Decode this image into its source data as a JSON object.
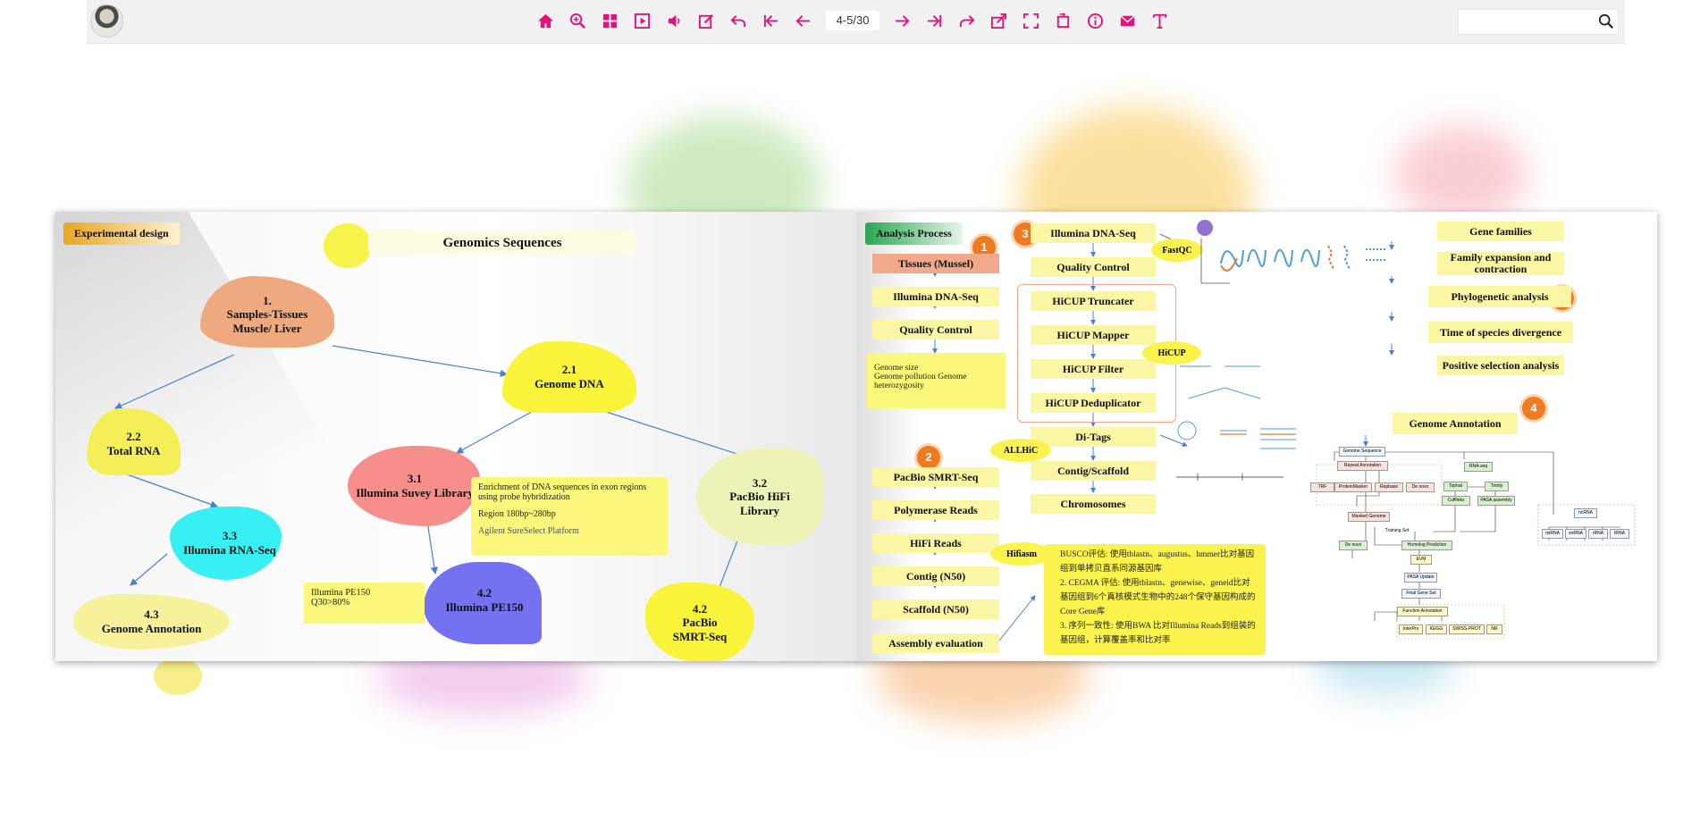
{
  "toolbar": {
    "page_indicator": "4-5/30",
    "search_placeholder": "",
    "icons": [
      "home-icon",
      "zoom-in-icon",
      "thumbnails-icon",
      "autoplay-icon",
      "sound-icon",
      "annotate-icon",
      "back-icon",
      "first-page-icon",
      "prev-page-icon",
      "next-page-icon",
      "last-page-icon",
      "forward-icon",
      "share-icon",
      "fullscreen-icon",
      "rotate-icon",
      "info-icon",
      "email-icon",
      "text-icon"
    ],
    "accent_color": "#e2137a"
  },
  "left_page": {
    "tag": "Experimental design",
    "title": "Genomics Sequences",
    "nodes": {
      "n1": "1.\nSamples-Tissues\nMuscle/ Liver",
      "n21": "2.1\nGenome DNA",
      "n22": "2.2\nTotal RNA",
      "n31": "3.1\nIllumina Suvey Library",
      "n32": "3.2\nPacBio HiFi\nLibrary",
      "n33": "3.3\nIllumina RNA-Seq",
      "n42a": "4.2\nIllumina PE150",
      "n42b": "4.2\nPacBio\nSMRT-Seq",
      "n43": "4.3\nGenome Annotation"
    },
    "note_enrich": "Enrichment of DNA sequences in exon regions using probe hybridization",
    "note_region": "Region 180bp~280bp",
    "note_platform": "Agilent SureSelect Platform",
    "note_pe150_1": "Illumina PE150",
    "note_pe150_2": "Q30>80%"
  },
  "right_page": {
    "tag": "Analysis Process",
    "col1": [
      "Tissues (Mussel)",
      "Illumina DNA-Seq",
      "Quality Control"
    ],
    "col1_note": [
      "Genome size",
      "Genome pollution Genome",
      "heterozygosity"
    ],
    "col1b": [
      "PacBio SMRT-Seq",
      "Polymerase Reads",
      "HiFi Reads",
      "Contig (N50)",
      "Scaffold (N50)",
      "Assembly evaluation"
    ],
    "col2": [
      "Illumina DNA-Seq",
      "Quality Control",
      "HiCUP Truncater",
      "HiCUP Mapper",
      "HiCUP Filter",
      "HiCUP Deduplicator",
      "Di-Tags",
      "Contig/Scaffold",
      "Chromosomes"
    ],
    "ovals": {
      "fastqc": "FastQC",
      "hicup": "HiCUP",
      "allhic": "ALLHiC",
      "hifiasm": "Hifiasm"
    },
    "eval_notes": [
      "BUSCO评估: 使用tblastn、augustus、hmmer比对基因组到单拷贝直系同源基因库",
      "2.   CEGMA 评估: 使用tblastn、genewise、geneid比对基因组到6个真核模式生物中的248个保守基因构成的Core Gene库",
      "3.   序列一致性: 使用BWA 比对Illumina Reads到组装的基因组，计算覆盖率和比对率"
    ],
    "col4": [
      "Gene families",
      "Family expansion and contraction",
      "Phylogenetic analysis",
      "Time of species divergence",
      "Positive selection analysis"
    ],
    "annotation_title": "Genome Annotation",
    "badges": [
      "1",
      "2",
      "3",
      "4",
      "5"
    ],
    "mini_labels": [
      "Genome Sequence",
      "Repeat Annotation",
      "TRF",
      "ProteinMasker",
      "Repbase",
      "De novo",
      "RNA-seq",
      "Tophat",
      "Trinity",
      "Cufflinks",
      "PASA assembly",
      "Masked Genome",
      "Training Set",
      "De novo",
      "Homolog Prediction",
      "EVM",
      "PASA Update",
      "Final Gene Set",
      "Function Annotation",
      "InterPro",
      "KEGG",
      "SWISS-PROT",
      "NR",
      "ncRNA",
      "miRNA",
      "snRNA",
      "rRNA",
      "tRNA"
    ]
  }
}
